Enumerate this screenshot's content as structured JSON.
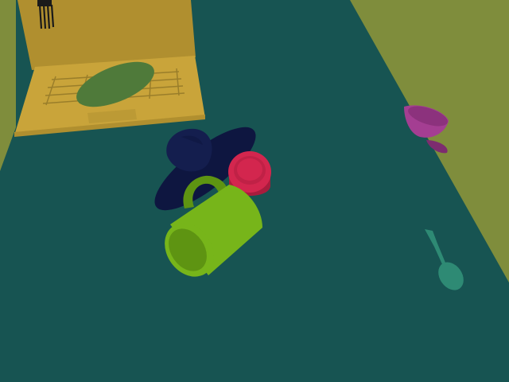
{
  "scene": {
    "description_hidden": "",
    "colors": {
      "wall_left": "#7f8d3c",
      "wall_right": "#7f8d3c",
      "table": "#175452",
      "laptop": "#c9a43a",
      "laptop_dark": "#b08f2f",
      "laptop_key": "#9a7e2a",
      "leaf": "#4f7a3a",
      "fork": "#1a1a1a",
      "hat": "#141e4e",
      "hat_dark": "#0e1640",
      "can": "#d3264e",
      "can_dark": "#a81c3d",
      "mug": "#77b51a",
      "mug_dark": "#5e9412",
      "bowl": "#a43e92",
      "bowl_dark": "#7d2c6f",
      "spoon": "#2e8a74"
    },
    "objects": [
      "laptop-icon",
      "leaf-icon",
      "fork-icon",
      "hat-icon",
      "can-icon",
      "mug-icon",
      "bowl-icon",
      "spoon-icon"
    ]
  }
}
